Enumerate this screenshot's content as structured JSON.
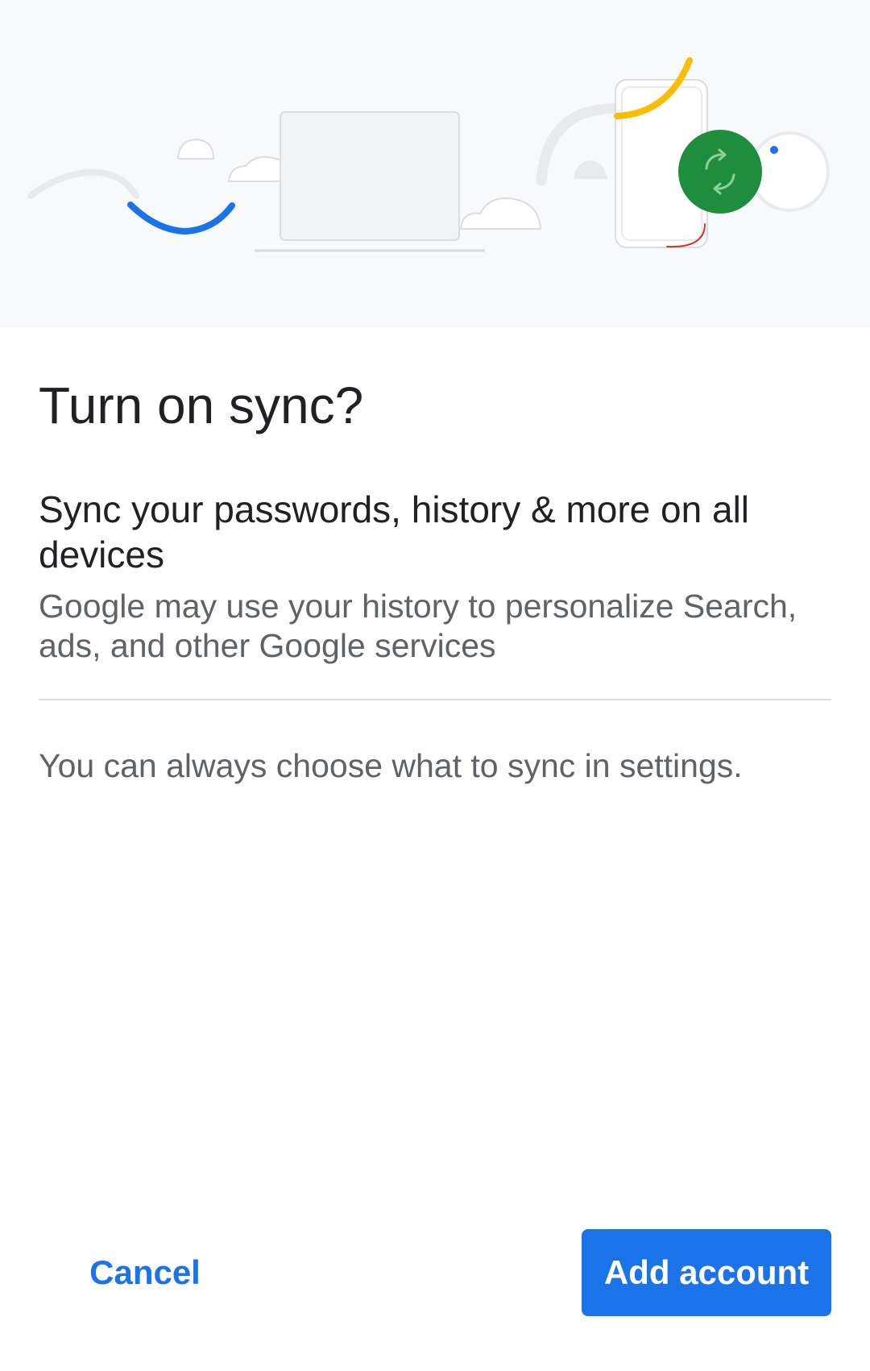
{
  "dialog": {
    "title": "Turn on sync?",
    "heading": "Sync your passwords, history & more on all devices",
    "subtext": "Google may use your history to personalize Search, ads, and other Google services",
    "note": "You can always choose what to sync in settings."
  },
  "actions": {
    "cancel_label": "Cancel",
    "add_account_label": "Add account"
  },
  "illustration": {
    "icons": [
      "laptop-icon",
      "phone-icon",
      "sync-icon",
      "cloud-icon"
    ],
    "colors": {
      "background": "#f8f9fa",
      "blue": "#1a73e8",
      "yellow": "#fbbc04",
      "green": "#1e8e3e",
      "red": "#d93025",
      "gray": "#e8eaed"
    }
  },
  "colors": {
    "primary": "#1a73e8",
    "title_text": "#202124",
    "secondary_text": "#5f6368",
    "divider": "#dadce0"
  }
}
